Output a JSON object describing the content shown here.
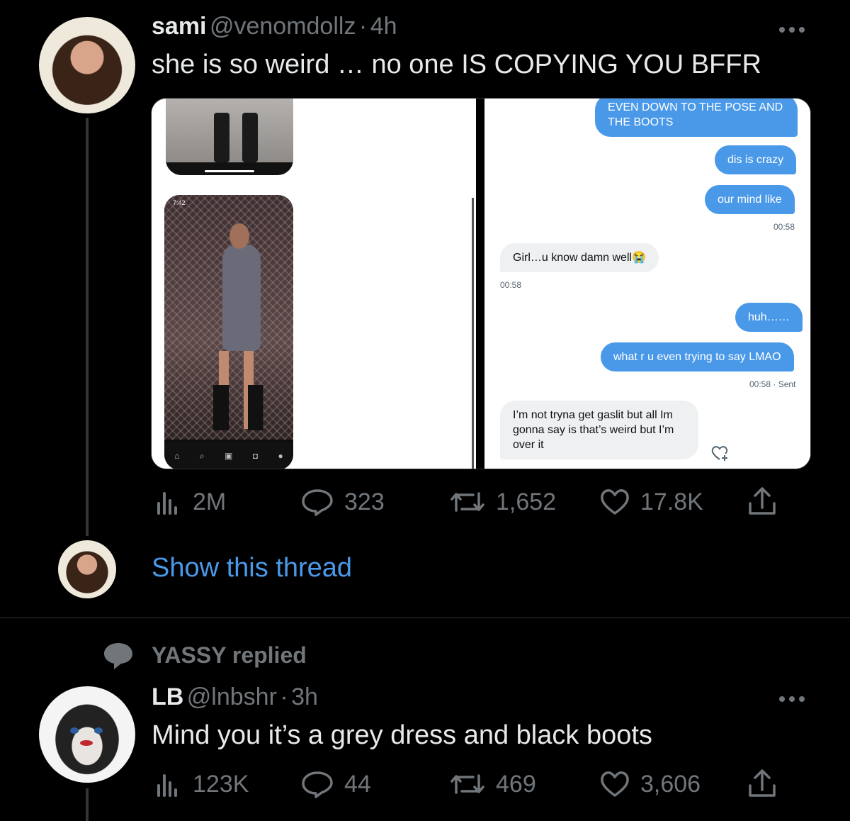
{
  "tweet1": {
    "name": "sami",
    "handle": "@venomdollz",
    "separator": "·",
    "time": "4h",
    "text": "she is so weird … no one IS COPYING YOU BFFR",
    "media": {
      "phone_status_time": "7:42",
      "chat": [
        {
          "dir": "out",
          "text": "EVEN DOWN TO THE POSE AND THE BOOTS"
        },
        {
          "dir": "out",
          "text": "dis is crazy"
        },
        {
          "dir": "out",
          "text": "our mind like"
        },
        {
          "dir": "ts",
          "text": "00:58"
        },
        {
          "dir": "in",
          "text": "Girl…u know damn well😭"
        },
        {
          "dir": "ts",
          "text": "00:58"
        },
        {
          "dir": "out",
          "text": "huh……"
        },
        {
          "dir": "out",
          "text": "what r u even trying to say LMAO"
        },
        {
          "dir": "ts",
          "text": "00:58 · Sent"
        },
        {
          "dir": "in",
          "text": "I’m not tryna get gaslit but all Im gonna say is that’s weird but I’m over it"
        }
      ]
    },
    "stats": {
      "views": "2M",
      "replies": "323",
      "retweets": "1,652",
      "likes": "17.8K"
    }
  },
  "show_thread": "Show this thread",
  "reply_context": "YASSY replied",
  "tweet2": {
    "name": "LB",
    "handle": "@lnbshr",
    "separator": "·",
    "time": "3h",
    "text": "Mind you it’s a grey dress and black boots",
    "stats": {
      "views": "123K",
      "replies": "44",
      "retweets": "469",
      "likes": "3,606"
    }
  },
  "colors": {
    "background": "#000000",
    "text_primary": "#e7e9ea",
    "text_secondary": "#71767b",
    "accent_blue": "#4a99e9",
    "divider": "#2f3336"
  },
  "icons": [
    "more-icon",
    "views-icon",
    "reply-icon",
    "retweet-icon",
    "like-icon",
    "share-icon",
    "speech-bubble-icon"
  ]
}
